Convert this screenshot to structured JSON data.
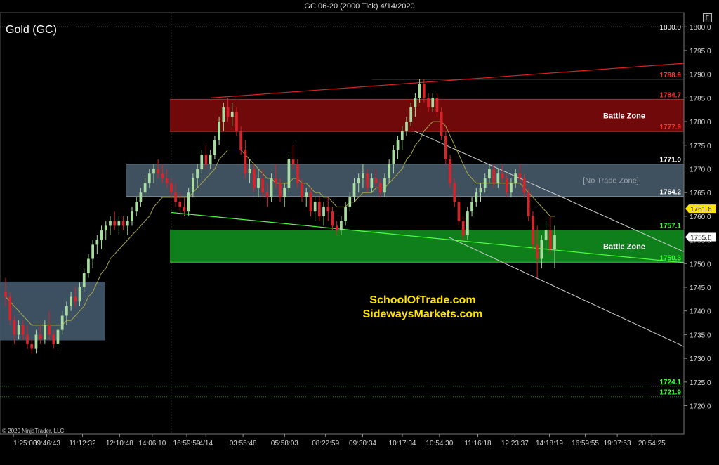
{
  "window_title": "GC 06-20 (2000 Tick)  4/14/2020",
  "corner_button": "F",
  "colors": {
    "up": "#a8dca0",
    "down": "#d8232a",
    "red_zone": "#7a0a0a",
    "green_zone": "#0f8a1c",
    "grey_zone": "#4a5e70",
    "blue_box": "#3f5466",
    "ma": "#a8a64a",
    "url_text": "#ffe400"
  },
  "chart_data": {
    "type": "candlestick",
    "title": "Gold (GC)",
    "copyright": "© 2020 NinjaTrader, LLC",
    "ylim": [
      1714,
      1803
    ],
    "y_ticks": [
      1720.0,
      1725.0,
      1730.0,
      1735.0,
      1740.0,
      1745.0,
      1750.0,
      1755.0,
      1760.0,
      1765.0,
      1770.0,
      1775.0,
      1780.0,
      1785.0,
      1790.0,
      1795.0,
      1800.0
    ],
    "x_tick_labels": [
      "1:25:08",
      "09:46:43",
      "11:12:32",
      "12:10:48",
      "14:06:10",
      "16:59:59",
      "4/14",
      "03:55:48",
      "05:58:03",
      "08:22:59",
      "09:30:34",
      "10:17:34",
      "10:54:30",
      "11:16:18",
      "12:23:37",
      "14:18:19",
      "16:59:55",
      "19:07:53",
      "20:54:25",
      "4/14"
    ],
    "ohlc": [
      [
        1744,
        1747,
        1741,
        1743
      ],
      [
        1743,
        1744,
        1737,
        1738
      ],
      [
        1738,
        1739,
        1733,
        1735
      ],
      [
        1735,
        1738,
        1734,
        1737
      ],
      [
        1737,
        1738,
        1734,
        1735
      ],
      [
        1735,
        1737,
        1732,
        1733
      ],
      [
        1733,
        1734,
        1731,
        1732
      ],
      [
        1732,
        1736,
        1731,
        1735
      ],
      [
        1735,
        1737,
        1733,
        1734
      ],
      [
        1734,
        1738,
        1733,
        1737
      ],
      [
        1737,
        1740,
        1734,
        1735
      ],
      [
        1735,
        1736,
        1732,
        1733
      ],
      [
        1733,
        1737,
        1732,
        1736
      ],
      [
        1736,
        1740,
        1735,
        1739
      ],
      [
        1739,
        1742,
        1737,
        1741
      ],
      [
        1741,
        1744,
        1740,
        1743
      ],
      [
        1743,
        1745,
        1741,
        1742
      ],
      [
        1742,
        1746,
        1741,
        1745
      ],
      [
        1745,
        1749,
        1744,
        1748
      ],
      [
        1748,
        1752,
        1747,
        1751
      ],
      [
        1751,
        1755,
        1749,
        1754
      ],
      [
        1754,
        1756,
        1752,
        1755
      ],
      [
        1755,
        1758,
        1753,
        1757
      ],
      [
        1757,
        1759,
        1755,
        1758
      ],
      [
        1758,
        1760,
        1756,
        1759
      ],
      [
        1759,
        1761,
        1757,
        1758
      ],
      [
        1758,
        1760,
        1756,
        1759
      ],
      [
        1759,
        1760,
        1757,
        1758
      ],
      [
        1758,
        1760,
        1756,
        1759
      ],
      [
        1759,
        1762,
        1758,
        1761
      ],
      [
        1761,
        1764,
        1760,
        1763
      ],
      [
        1763,
        1766,
        1762,
        1765
      ],
      [
        1765,
        1768,
        1764,
        1767
      ],
      [
        1767,
        1770,
        1766,
        1769
      ],
      [
        1769,
        1771,
        1767,
        1770
      ],
      [
        1770,
        1772,
        1768,
        1769
      ],
      [
        1769,
        1771,
        1767,
        1768
      ],
      [
        1768,
        1770,
        1766,
        1767
      ],
      [
        1767,
        1768,
        1764,
        1765
      ],
      [
        1765,
        1767,
        1762,
        1763
      ],
      [
        1763,
        1765,
        1761,
        1762
      ],
      [
        1762,
        1764,
        1760,
        1761
      ],
      [
        1761,
        1766,
        1760,
        1765
      ],
      [
        1765,
        1769,
        1764,
        1768
      ],
      [
        1768,
        1771,
        1766,
        1770
      ],
      [
        1770,
        1774,
        1769,
        1773
      ],
      [
        1773,
        1775,
        1770,
        1771
      ],
      [
        1771,
        1774,
        1770,
        1773
      ],
      [
        1773,
        1777,
        1772,
        1776
      ],
      [
        1776,
        1781,
        1775,
        1780
      ],
      [
        1780,
        1784,
        1778,
        1783
      ],
      [
        1783,
        1785,
        1780,
        1781
      ],
      [
        1781,
        1784,
        1779,
        1782
      ],
      [
        1782,
        1783,
        1777,
        1778
      ],
      [
        1778,
        1779,
        1773,
        1774
      ],
      [
        1774,
        1776,
        1768,
        1769
      ],
      [
        1769,
        1772,
        1767,
        1770
      ],
      [
        1770,
        1771,
        1765,
        1766
      ],
      [
        1766,
        1770,
        1764,
        1768
      ],
      [
        1768,
        1770,
        1764,
        1765
      ],
      [
        1765,
        1767,
        1762,
        1764
      ],
      [
        1764,
        1769,
        1763,
        1768
      ],
      [
        1768,
        1771,
        1766,
        1767
      ],
      [
        1767,
        1768,
        1763,
        1764
      ],
      [
        1764,
        1767,
        1762,
        1766
      ],
      [
        1766,
        1773,
        1765,
        1772
      ],
      [
        1772,
        1775,
        1770,
        1771
      ],
      [
        1771,
        1772,
        1766,
        1767
      ],
      [
        1767,
        1768,
        1763,
        1764
      ],
      [
        1764,
        1766,
        1762,
        1765
      ],
      [
        1765,
        1766,
        1760,
        1761
      ],
      [
        1761,
        1764,
        1759,
        1763
      ],
      [
        1763,
        1764,
        1759,
        1760
      ],
      [
        1760,
        1763,
        1758,
        1762
      ],
      [
        1762,
        1764,
        1759,
        1761
      ],
      [
        1761,
        1762,
        1757,
        1758
      ],
      [
        1758,
        1759,
        1756,
        1757
      ],
      [
        1757,
        1760,
        1756,
        1759
      ],
      [
        1759,
        1763,
        1758,
        1762
      ],
      [
        1762,
        1765,
        1761,
        1764
      ],
      [
        1764,
        1768,
        1763,
        1767
      ],
      [
        1767,
        1769,
        1765,
        1768
      ],
      [
        1768,
        1771,
        1766,
        1769
      ],
      [
        1769,
        1770,
        1765,
        1766
      ],
      [
        1766,
        1769,
        1765,
        1768
      ],
      [
        1768,
        1770,
        1766,
        1767
      ],
      [
        1767,
        1768,
        1764,
        1765
      ],
      [
        1765,
        1769,
        1764,
        1768
      ],
      [
        1768,
        1772,
        1767,
        1771
      ],
      [
        1771,
        1775,
        1769,
        1774
      ],
      [
        1774,
        1777,
        1772,
        1776
      ],
      [
        1776,
        1779,
        1774,
        1778
      ],
      [
        1778,
        1781,
        1777,
        1780
      ],
      [
        1780,
        1784,
        1779,
        1783
      ],
      [
        1783,
        1786,
        1781,
        1785
      ],
      [
        1785,
        1789,
        1784,
        1788
      ],
      [
        1788,
        1789,
        1784,
        1785
      ],
      [
        1785,
        1786,
        1782,
        1783
      ],
      [
        1783,
        1786,
        1782,
        1785
      ],
      [
        1785,
        1786,
        1781,
        1782
      ],
      [
        1782,
        1783,
        1776,
        1777
      ],
      [
        1777,
        1778,
        1771,
        1772
      ],
      [
        1772,
        1773,
        1766,
        1767
      ],
      [
        1767,
        1768,
        1762,
        1763
      ],
      [
        1763,
        1764,
        1758,
        1759
      ],
      [
        1759,
        1760,
        1755,
        1756
      ],
      [
        1756,
        1762,
        1755,
        1761
      ],
      [
        1761,
        1764,
        1760,
        1763
      ],
      [
        1763,
        1766,
        1762,
        1765
      ],
      [
        1765,
        1767,
        1763,
        1766
      ],
      [
        1766,
        1769,
        1765,
        1768
      ],
      [
        1768,
        1771,
        1767,
        1770
      ],
      [
        1770,
        1771,
        1766,
        1767
      ],
      [
        1767,
        1770,
        1766,
        1769
      ],
      [
        1769,
        1771,
        1767,
        1768
      ],
      [
        1768,
        1769,
        1764,
        1765
      ],
      [
        1765,
        1768,
        1764,
        1767
      ],
      [
        1767,
        1770,
        1766,
        1769
      ],
      [
        1769,
        1771,
        1767,
        1768
      ],
      [
        1768,
        1769,
        1764,
        1765
      ],
      [
        1765,
        1766,
        1759,
        1760
      ],
      [
        1760,
        1761,
        1753,
        1754
      ],
      [
        1754,
        1758,
        1747,
        1751
      ],
      [
        1751,
        1756,
        1749,
        1755
      ],
      [
        1755,
        1759,
        1753,
        1757
      ],
      [
        1757,
        1760,
        1752,
        1753
      ],
      [
        1753,
        1758,
        1749,
        1756
      ]
    ],
    "ma_values": [
      1743,
      1742,
      1741,
      1740,
      1739,
      1738,
      1737,
      1737,
      1737,
      1737,
      1737,
      1737,
      1737,
      1737,
      1738,
      1738,
      1739,
      1740,
      1741,
      1743,
      1744,
      1746,
      1748,
      1749,
      1751,
      1752,
      1753,
      1754,
      1755,
      1756,
      1757,
      1758,
      1759,
      1760,
      1762,
      1763,
      1764,
      1764,
      1764,
      1764,
      1764,
      1764,
      1764,
      1765,
      1766,
      1767,
      1768,
      1769,
      1770,
      1772,
      1773,
      1774,
      1774,
      1774,
      1774,
      1773,
      1772,
      1771,
      1770,
      1769,
      1768,
      1768,
      1767,
      1767,
      1767,
      1767,
      1768,
      1768,
      1767,
      1767,
      1766,
      1765,
      1765,
      1764,
      1764,
      1763,
      1762,
      1762,
      1762,
      1763,
      1763,
      1764,
      1765,
      1765,
      1765,
      1766,
      1766,
      1766,
      1767,
      1768,
      1769,
      1770,
      1772,
      1773,
      1775,
      1776,
      1778,
      1779,
      1780,
      1780,
      1780,
      1779,
      1777,
      1775,
      1773,
      1771,
      1769,
      1768,
      1767,
      1767,
      1767,
      1767,
      1767,
      1767,
      1767,
      1767,
      1767,
      1767,
      1767,
      1766,
      1765,
      1764,
      1763,
      1762,
      1761,
      1760,
      1760
    ],
    "zones": [
      {
        "label": "Battle Zone",
        "top": 1784.7,
        "bottom": 1777.9,
        "top_label": "1784.7",
        "bottom_label": "1777.9",
        "color": "#7a0a0a",
        "label_color": "#ffffff"
      },
      {
        "label": "[No Trade Zone]",
        "top": 1771.0,
        "bottom": 1764.2,
        "top_label": "1771.0",
        "bottom_label": "1764.2",
        "color": "#4a5e70",
        "label_color": "#9aa4ad"
      },
      {
        "label": "Battle Zone",
        "top": 1757.1,
        "bottom": 1750.3,
        "top_label": "1757.1",
        "bottom_label": "1750.3",
        "color": "#0f8a1c",
        "label_color": "#ffffff"
      }
    ],
    "level_labels": [
      {
        "text": "1788.9",
        "value": 1788.9,
        "color": "#ff3030"
      },
      {
        "text": "1724.1",
        "value": 1724.1,
        "color": "#33ff33"
      },
      {
        "text": "1721.9",
        "value": 1721.9,
        "color": "#33ff33"
      }
    ],
    "price_tags": [
      {
        "text": "1761.6",
        "value": 1761.6,
        "bg": "#ffe400",
        "fg": "#000000"
      },
      {
        "text": "1755.6",
        "value": 1755.6,
        "bg": "#ffffff",
        "fg": "#000000"
      }
    ],
    "left_box": {
      "top": 1746.2,
      "bottom": 1733.8
    },
    "axis_top_label": "1800.0",
    "annotations": [
      "SchoolOfTrade.com",
      "SidewaysMarkets.com"
    ]
  }
}
